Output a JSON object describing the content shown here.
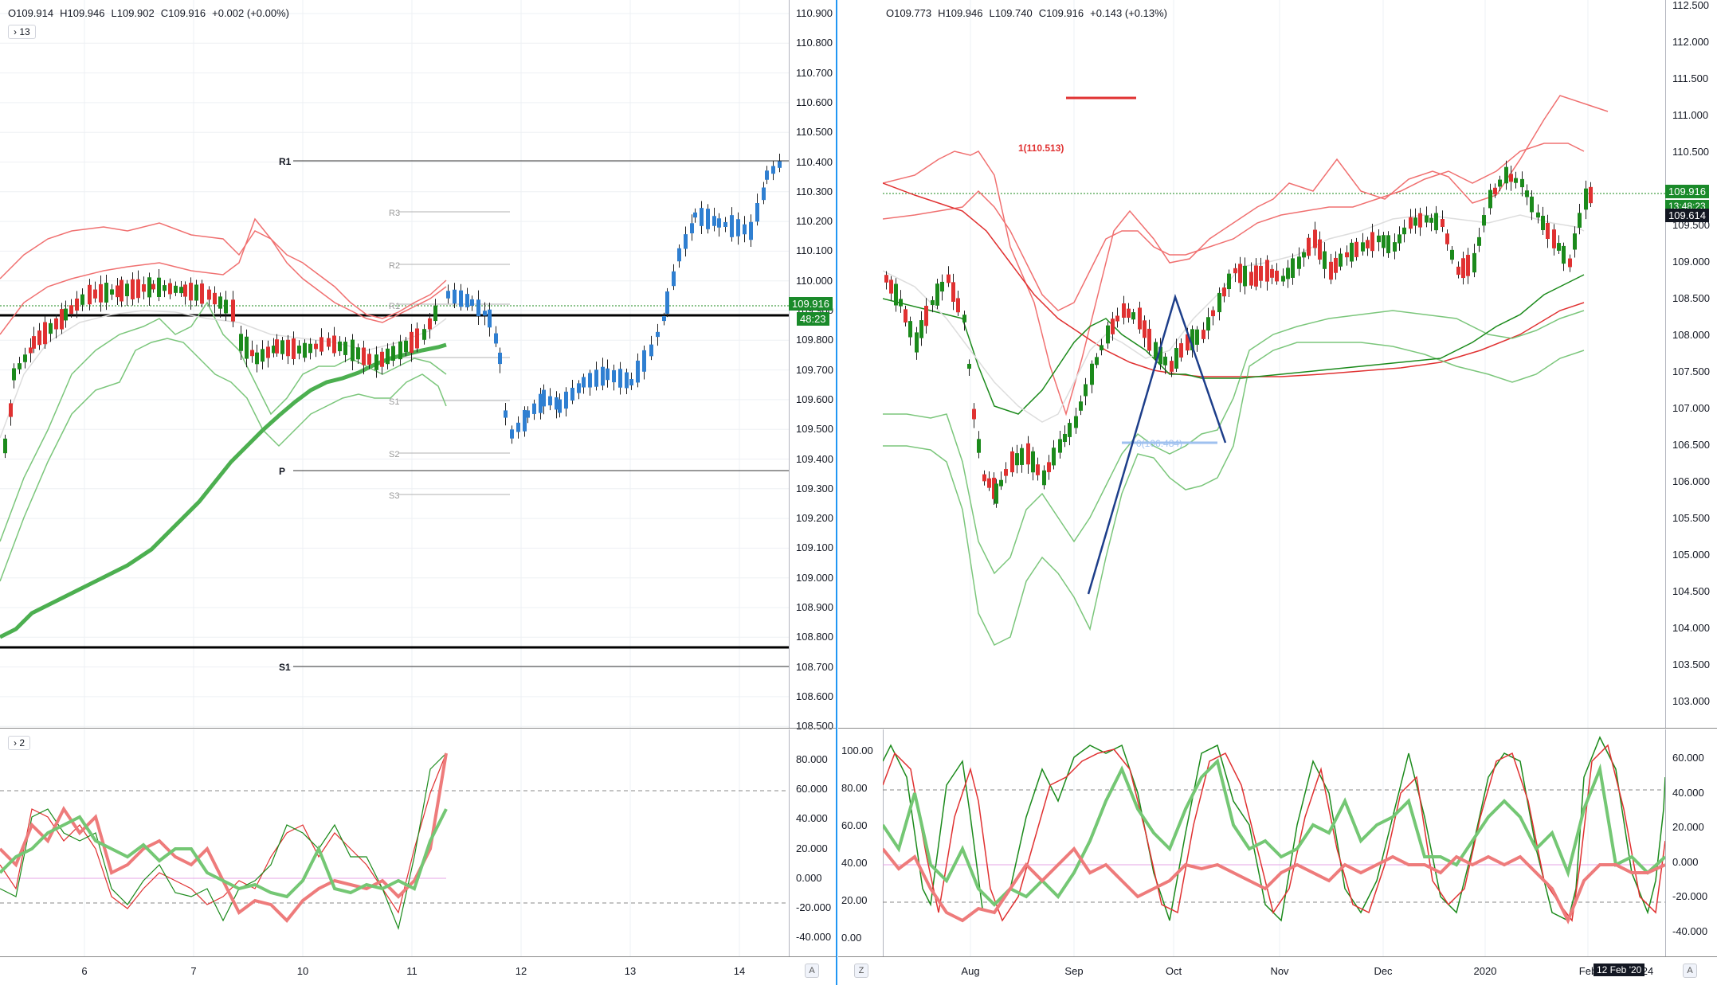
{
  "left": {
    "ohlc": {
      "o": "O109.914",
      "h": "H109.946",
      "l": "L109.902",
      "c": "C109.916",
      "chg": "+0.002 (+0.00%)"
    },
    "collapse_main": "13",
    "collapse_osc": "2",
    "price_ticks": [
      "110.900",
      "110.800",
      "110.700",
      "110.600",
      "110.500",
      "110.400",
      "110.300",
      "110.200",
      "110.100",
      "110.000",
      "109.900",
      "109.800",
      "109.700",
      "109.600",
      "109.500",
      "109.400",
      "109.300",
      "109.200",
      "109.100",
      "109.000",
      "108.900",
      "108.800",
      "108.700",
      "108.600",
      "108.500"
    ],
    "price_tag": "109.916",
    "countdown": "48:23",
    "osc_ticks": [
      "80.000",
      "60.000",
      "40.000",
      "20.000",
      "0.000",
      "-20.000",
      "-40.000"
    ],
    "x_ticks": [
      "6",
      "7",
      "10",
      "11",
      "12",
      "13",
      "14"
    ],
    "pivot_labels": {
      "r1": "R1",
      "p": "P",
      "s1": "S1"
    },
    "pivot_small": {
      "r3": "R3",
      "r2": "R2",
      "r1": "R1",
      "s1": "S1",
      "s2": "S2",
      "s3": "S3"
    },
    "corner": "A"
  },
  "right": {
    "ohlc": {
      "o": "O109.773",
      "h": "H109.946",
      "l": "L109.740",
      "c": "C109.916",
      "chg": "+0.143 (+0.13%)"
    },
    "price_ticks": [
      "112.500",
      "112.000",
      "111.500",
      "111.000",
      "110.500",
      "110.000",
      "109.500",
      "109.000",
      "108.500",
      "108.000",
      "107.500",
      "107.000",
      "106.500",
      "106.000",
      "105.500",
      "105.000",
      "104.500",
      "104.000",
      "103.500",
      "103.000"
    ],
    "price_tag": "109.916",
    "countdown": "13:48:23",
    "secondary_tag": "109.614",
    "fib_top": "1(110.513)",
    "fib_bottom": "0(106.484)",
    "osc_left_ticks": [
      "100.00",
      "80.00",
      "60.00",
      "40.00",
      "20.00",
      "0.00"
    ],
    "osc_right_ticks": [
      "60.000",
      "40.000",
      "20.000",
      "0.000",
      "-20.000",
      "-40.000"
    ],
    "x_ticks": [
      "Aug",
      "Sep",
      "Oct",
      "Nov",
      "Dec",
      "2020",
      "Feb",
      "24"
    ],
    "date_badge": "12 Feb '20",
    "corner_left": "Z",
    "corner_right": "A"
  },
  "colors": {
    "up": "#1b8a1b",
    "down": "#e03131",
    "blue": "#2f7fd1",
    "band_red": "#f07070",
    "band_green": "#7bc67b",
    "tag_green": "#1a8a2a",
    "dark_tag": "#131722",
    "navy": "#1d3e8a"
  }
}
